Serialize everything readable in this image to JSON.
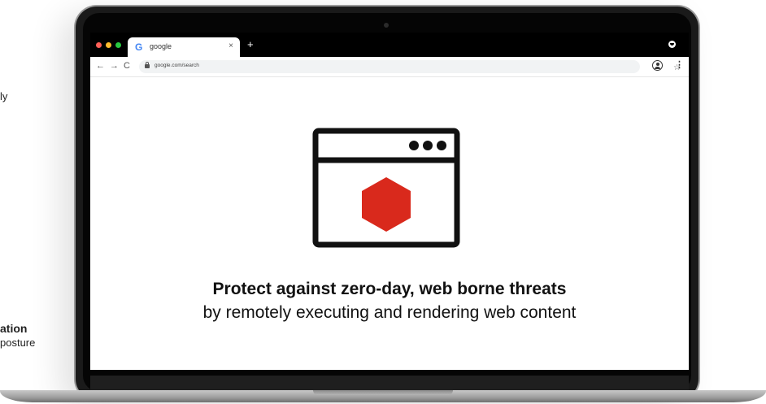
{
  "side_texts": {
    "top": "ly",
    "bottom_heading": "ation",
    "bottom_sub": "posture"
  },
  "browser": {
    "window_controls": {
      "close_color": "#ff5f57",
      "minimize_color": "#febc2e",
      "maximize_color": "#28c840"
    },
    "tab": {
      "favicon": "G",
      "title": "google",
      "close_label": "×"
    },
    "new_tab_label": "+",
    "toolbar": {
      "back_label": "←",
      "forward_label": "→",
      "reload_label": "C",
      "url": "google.com/search",
      "bookmark_label": "☆",
      "menu_label": "⋮"
    }
  },
  "content": {
    "headline": "Protect against zero-day, web borne threats",
    "subline": "by remotely executing and rendering web content",
    "accent_color": "#d9291c"
  }
}
